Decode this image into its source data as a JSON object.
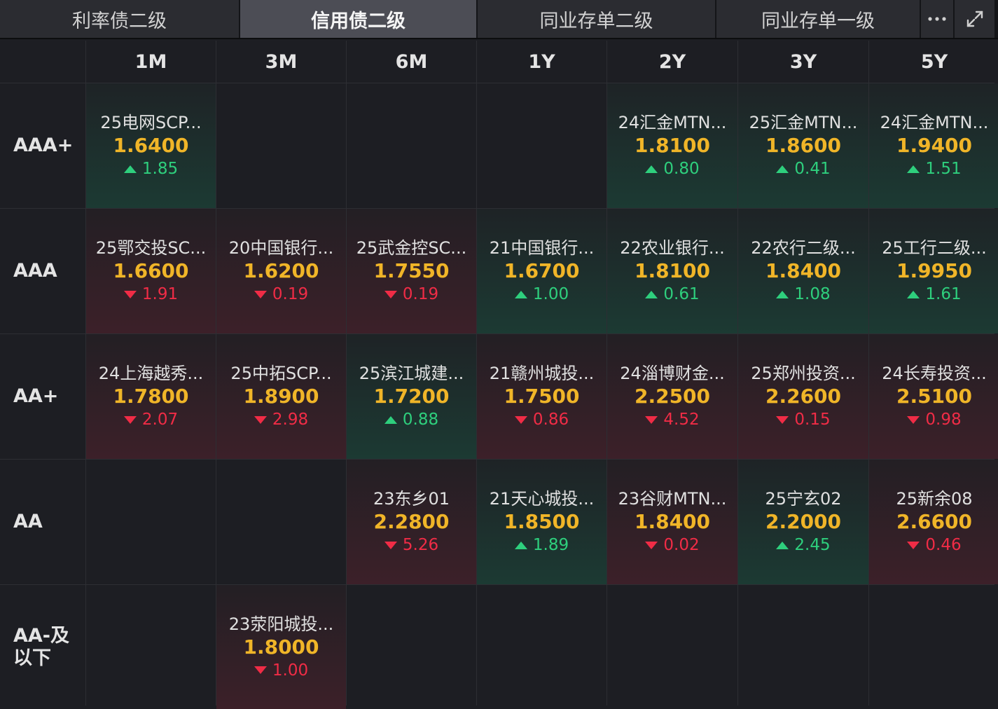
{
  "tabs": [
    {
      "label": "利率债二级",
      "active": false
    },
    {
      "label": "信用债二级",
      "active": true
    },
    {
      "label": "同业存单二级",
      "active": false
    },
    {
      "label": "同业存单一级",
      "active": false
    }
  ],
  "toolbar": {
    "more_icon": "more-icon",
    "expand_icon": "expand-icon"
  },
  "colors": {
    "rate": "#f0b528",
    "up": "#2ecf7d",
    "down": "#f02c46"
  },
  "columns": [
    "1M",
    "3M",
    "6M",
    "1Y",
    "2Y",
    "3Y",
    "5Y"
  ],
  "rows": [
    {
      "label": "AAA+",
      "cells": [
        {
          "name": "25电网SCP...",
          "rate": "1.6400",
          "change": "1.85",
          "dir": "up"
        },
        null,
        null,
        null,
        {
          "name": "24汇金MTN...",
          "rate": "1.8100",
          "change": "0.80",
          "dir": "up"
        },
        {
          "name": "25汇金MTN...",
          "rate": "1.8600",
          "change": "0.41",
          "dir": "up"
        },
        {
          "name": "24汇金MTN...",
          "rate": "1.9400",
          "change": "1.51",
          "dir": "up"
        }
      ]
    },
    {
      "label": "AAA",
      "cells": [
        {
          "name": "25鄂交投SC...",
          "rate": "1.6600",
          "change": "1.91",
          "dir": "down"
        },
        {
          "name": "20中国银行...",
          "rate": "1.6200",
          "change": "0.19",
          "dir": "down"
        },
        {
          "name": "25武金控SC...",
          "rate": "1.7550",
          "change": "0.19",
          "dir": "down"
        },
        {
          "name": "21中国银行...",
          "rate": "1.6700",
          "change": "1.00",
          "dir": "up"
        },
        {
          "name": "22农业银行...",
          "rate": "1.8100",
          "change": "0.61",
          "dir": "up"
        },
        {
          "name": "22农行二级...",
          "rate": "1.8400",
          "change": "1.08",
          "dir": "up"
        },
        {
          "name": "25工行二级...",
          "rate": "1.9950",
          "change": "1.61",
          "dir": "up"
        }
      ]
    },
    {
      "label": "AA+",
      "cells": [
        {
          "name": "24上海越秀...",
          "rate": "1.7800",
          "change": "2.07",
          "dir": "down"
        },
        {
          "name": "25中拓SCP...",
          "rate": "1.8900",
          "change": "2.98",
          "dir": "down"
        },
        {
          "name": "25滨江城建...",
          "rate": "1.7200",
          "change": "0.88",
          "dir": "up"
        },
        {
          "name": "21赣州城投...",
          "rate": "1.7500",
          "change": "0.86",
          "dir": "down"
        },
        {
          "name": "24淄博财金...",
          "rate": "2.2500",
          "change": "4.52",
          "dir": "down"
        },
        {
          "name": "25郑州投资...",
          "rate": "2.2600",
          "change": "0.15",
          "dir": "down"
        },
        {
          "name": "24长寿投资...",
          "rate": "2.5100",
          "change": "0.98",
          "dir": "down"
        }
      ]
    },
    {
      "label": "AA",
      "cells": [
        null,
        null,
        {
          "name": "23东乡01",
          "rate": "2.2800",
          "change": "5.26",
          "dir": "down"
        },
        {
          "name": "21天心城投...",
          "rate": "1.8500",
          "change": "1.89",
          "dir": "up"
        },
        {
          "name": "23谷财MTN...",
          "rate": "1.8400",
          "change": "0.02",
          "dir": "down"
        },
        {
          "name": "25宁玄02",
          "rate": "2.2000",
          "change": "2.45",
          "dir": "up"
        },
        {
          "name": "25新余08",
          "rate": "2.6600",
          "change": "0.46",
          "dir": "down"
        }
      ]
    },
    {
      "label": "AA-及以下",
      "label_lines": [
        "AA-及",
        "以下"
      ],
      "cells": [
        null,
        {
          "name": "23荥阳城投...",
          "rate": "1.8000",
          "change": "1.00",
          "dir": "down"
        },
        null,
        null,
        null,
        null,
        null
      ]
    }
  ]
}
